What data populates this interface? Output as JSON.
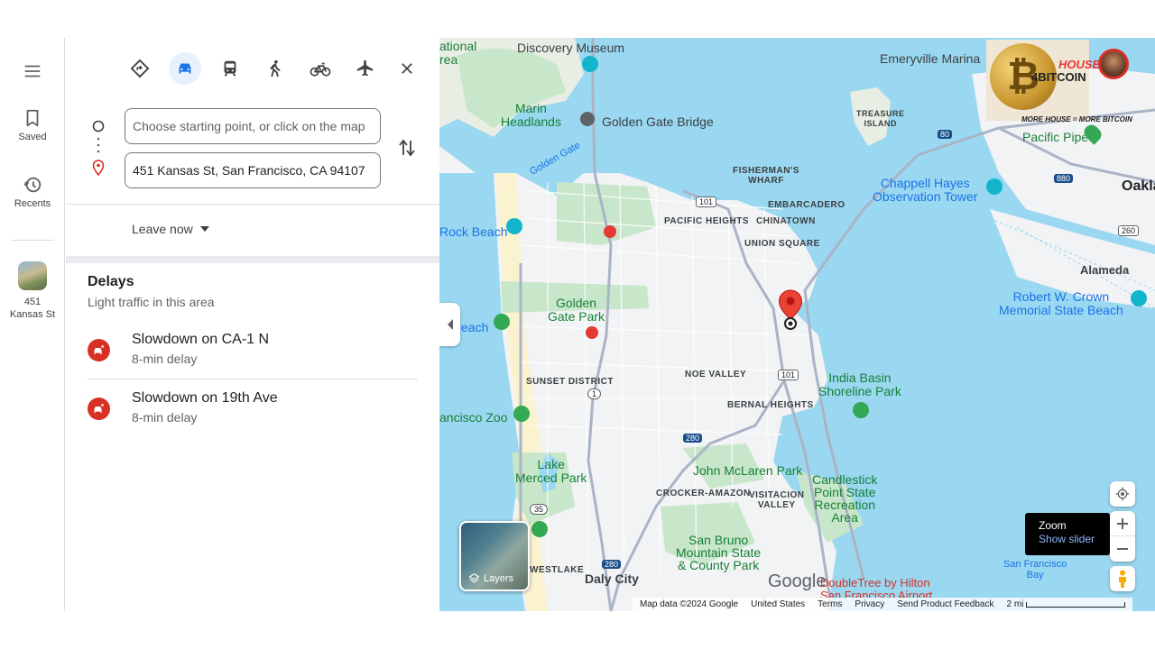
{
  "rail": {
    "saved_label": "Saved",
    "recents_label": "Recents",
    "recent_place_label": "451\nKansas St"
  },
  "directions": {
    "modes": [
      "best-route",
      "driving",
      "transit",
      "walking",
      "cycling",
      "flights"
    ],
    "active_mode": "driving",
    "start_placeholder": "Choose starting point, or click on the map",
    "start_value": "",
    "destination_value": "451 Kansas St, San Francisco, CA 94107",
    "leave_label": "Leave now"
  },
  "delays": {
    "title": "Delays",
    "subtitle": "Light traffic in this area",
    "items": [
      {
        "title": "Slowdown on CA-1 N",
        "detail": "8-min delay"
      },
      {
        "title": "Slowdown on 19th Ave",
        "detail": "8-min delay"
      }
    ]
  },
  "map": {
    "labels": {
      "discovery": "Discovery Museum",
      "national_area": "ational\nrea",
      "emeryville": "Emeryville Marina",
      "treasure": "TREASURE\nISLAND",
      "marin": "Marin\nHeadlands",
      "ggbridge": "Golden Gate Bridge",
      "pacific_pipe": "Pacific Pipe",
      "oakland": "Oaklan",
      "golden_gate": "Golden Gate",
      "fishermans": "FISHERMAN'S\nWHARF",
      "embarcadero": "EMBARCADERO",
      "chappell": "Chappell Hayes\nObservation Tower",
      "pacific_heights": "PACIFIC HEIGHTS",
      "chinatown": "CHINATOWN",
      "rock_beach": "Rock Beach",
      "union_square": "UNION SQUARE",
      "alameda": "Alameda",
      "gg_park": "Golden\nGate Park",
      "crown": "Robert W. Crown\nMemorial State Beach",
      "beach": "each",
      "noe": "NOE VALLEY",
      "sunset": "SUNSET DISTRICT",
      "india_basin": "India Basin\nShoreline Park",
      "bernal": "BERNAL HEIGHTS",
      "zoo": "ancisco Zoo",
      "lake_merced": "Lake\nMerced Park",
      "mclaren": "John McLaren Park",
      "candlestick": "Candlestick\nPoint State\nRecreation\nArea",
      "crocker": "CROCKER-AMAZON",
      "visitacion": "VISITACION\nVALLEY",
      "san_bruno": "San Bruno\nMountain State\n& County Park",
      "sf_bay": "San Francisco\nBay",
      "westlake": "WESTLAKE",
      "daly": "Daly City",
      "doubletree": "DoubleTree by Hilton\nSan Francisco Airport",
      "google": "Google",
      "more_house": "MORE HOUSE = MORE BITCOIN",
      "fourbitcoin": "4BITCOIN",
      "house": "HOUSE"
    },
    "shields": {
      "us101_north": "101",
      "i80": "80",
      "i880": "880",
      "ca1": "1",
      "us101_south": "101",
      "i280_north": "280",
      "ca35": "35",
      "i280_south": "280",
      "ca260": "260"
    },
    "layers_label": "Layers",
    "zoom_tooltip": {
      "title": "Zoom",
      "link": "Show slider"
    },
    "footer": {
      "data": "Map data ©2024 Google",
      "country": "United States",
      "terms": "Terms",
      "privacy": "Privacy",
      "feedback": "Send Product Feedback",
      "scale": "2 mi"
    },
    "colors": {
      "water": "#9ad7f0",
      "land": "#f1f3f4",
      "park": "#c8e6c9",
      "highway": "#aab4c6",
      "pin": "#ea4335"
    }
  }
}
